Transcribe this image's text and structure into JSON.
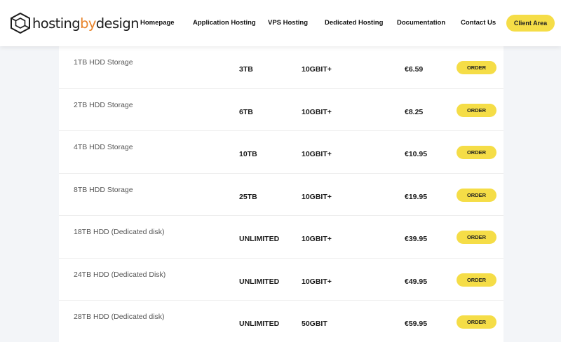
{
  "header": {
    "logo": {
      "text_main": "hosting",
      "text_accent": "by",
      "text_end": "design",
      "icon": "cube-logo-icon"
    },
    "nav": [
      {
        "label": "Homepage"
      },
      {
        "label": "Application Hosting"
      },
      {
        "label": "VPS Hosting"
      },
      {
        "label": "Dedicated Hosting"
      },
      {
        "label": "Documentation"
      },
      {
        "label": "Contact Us"
      }
    ],
    "client_area_label": "Client Area"
  },
  "colors": {
    "accent_yellow": "#f5dd47",
    "logo_orange": "#e8832a",
    "page_bg": "#f3f5f8"
  },
  "plans": [
    {
      "name": "1TB HDD Storage",
      "storage": "3TB",
      "speed": "10GBIT+",
      "price": "€6.59",
      "order_label": "ORDER"
    },
    {
      "name": "2TB HDD Storage",
      "storage": "6TB",
      "speed": "10GBIT+",
      "price": "€8.25",
      "order_label": "ORDER"
    },
    {
      "name": "4TB HDD Storage",
      "storage": "10TB",
      "speed": "10GBIT+",
      "price": "€10.95",
      "order_label": "ORDER"
    },
    {
      "name": "8TB HDD Storage",
      "storage": "25TB",
      "speed": "10GBIT+",
      "price": "€19.95",
      "order_label": "ORDER"
    },
    {
      "name": "18TB HDD (Dedicated disk)",
      "storage": "UNLIMITED",
      "speed": "10GBIT+",
      "price": "€39.95",
      "order_label": "ORDER"
    },
    {
      "name": "24TB HDD (Dedicated Disk)",
      "storage": "UNLIMITED",
      "speed": "10GBIT+",
      "price": "€49.95",
      "order_label": "ORDER"
    },
    {
      "name": "28TB HDD (Dedicated disk)",
      "storage": "UNLIMITED",
      "speed": "50GBIT",
      "price": "€59.95",
      "order_label": "ORDER"
    }
  ]
}
